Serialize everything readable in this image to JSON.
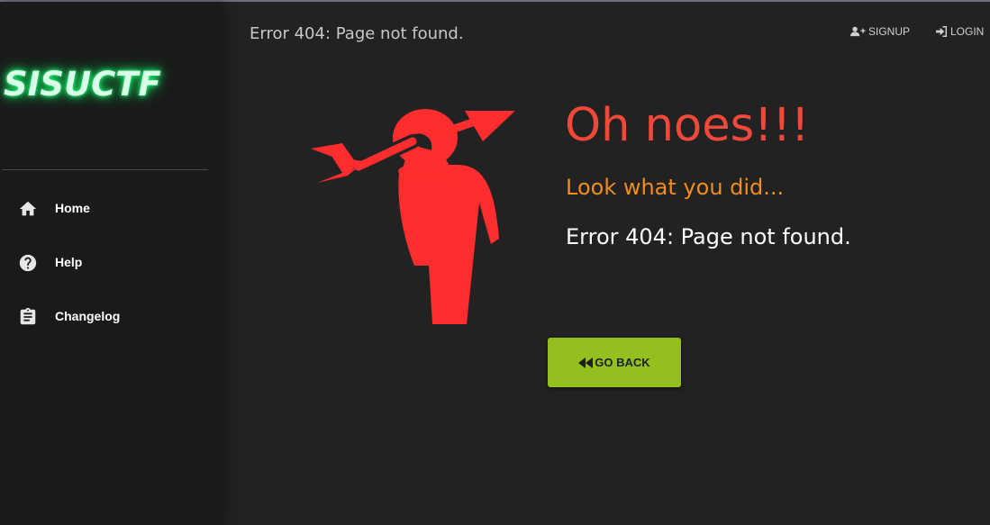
{
  "app": {
    "logo_text": "SISUCTF",
    "header_title": "Error 404: Page not found."
  },
  "sidebar": {
    "items": [
      {
        "label": "Home",
        "icon": "home-icon"
      },
      {
        "label": "Help",
        "icon": "help-circle-icon"
      },
      {
        "label": "Changelog",
        "icon": "clipboard-icon"
      }
    ]
  },
  "header": {
    "signup_label": "SIGNUP",
    "login_label": "LOGIN"
  },
  "main": {
    "title": "Oh noes!!!",
    "subtitle": "Look what you did...",
    "message": "Error 404: Page not found.",
    "go_back_label": "GO BACK",
    "illustration_icon": "arrow-through-head-icon"
  },
  "colors": {
    "accent_red": "#f2483a",
    "accent_orange": "#f28c1a",
    "button_green": "#93c01f",
    "logo_glow": "#22ff77"
  }
}
